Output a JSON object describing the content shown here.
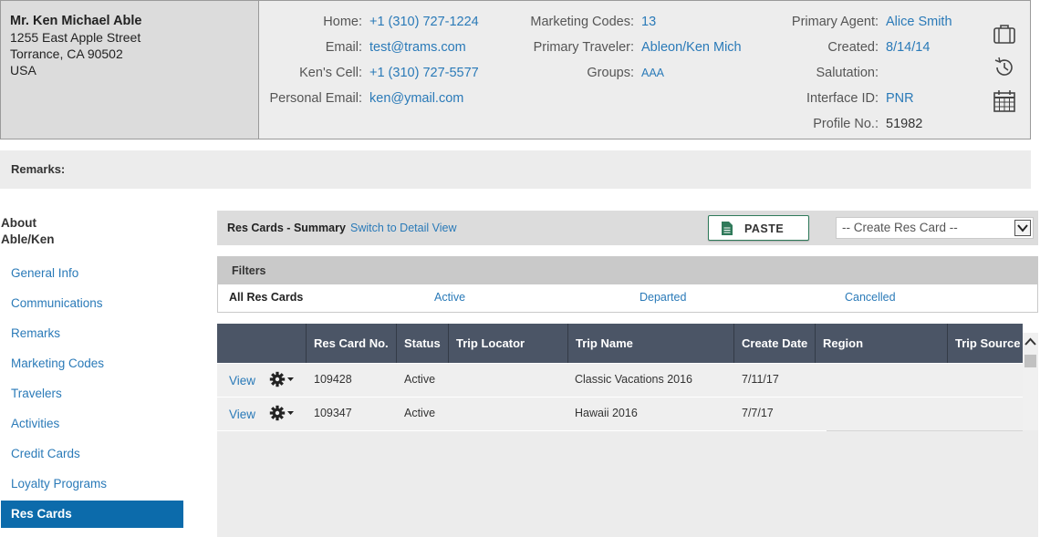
{
  "profile": {
    "name": "Mr. Ken Michael Able",
    "address_line1": "1255 East Apple Street",
    "address_line2": "Torrance, CA 90502",
    "country": "USA"
  },
  "contact": {
    "home_label": "Home:",
    "home_value": "+1 (310) 727-1224",
    "email_label": "Email:",
    "email_value": "test@trams.com",
    "cell_label": "Ken's Cell:",
    "cell_value": "+1 (310) 727-5577",
    "personal_email_label": "Personal Email:",
    "personal_email_value": "ken@ymail.com"
  },
  "marketing": {
    "codes_label": "Marketing Codes:",
    "codes_value": "13",
    "traveler_label": "Primary Traveler:",
    "traveler_value": "Ableon/Ken Mich",
    "groups_label": "Groups:",
    "groups_value": "AAA"
  },
  "agent": {
    "agent_label": "Primary Agent:",
    "agent_value": "Alice Smith",
    "created_label": "Created:",
    "created_value": "8/14/14",
    "salutation_label": "Salutation:",
    "salutation_value": "",
    "interface_label": "Interface ID:",
    "interface_value": "PNR",
    "profile_no_label": "Profile No.:",
    "profile_no_value": "51982"
  },
  "side_icons": [
    "briefcase-icon",
    "history-icon",
    "calendar-icon"
  ],
  "remarks": {
    "label": "Remarks:"
  },
  "about": {
    "line1": "About",
    "line2": "Able/Ken"
  },
  "nav": {
    "items": [
      {
        "label": "General Info"
      },
      {
        "label": "Communications"
      },
      {
        "label": "Remarks"
      },
      {
        "label": "Marketing Codes"
      },
      {
        "label": "Travelers"
      },
      {
        "label": "Activities"
      },
      {
        "label": "Credit Cards"
      },
      {
        "label": "Loyalty Programs"
      },
      {
        "label": "Res Cards"
      }
    ],
    "active": "Res Cards"
  },
  "summary": {
    "title": "Res Cards - Summary",
    "switch_link": "Switch to Detail View",
    "paste_label": "PASTE",
    "create_select": "-- Create Res Card --"
  },
  "filters": {
    "heading": "Filters",
    "options": [
      "All Res Cards",
      "Active",
      "Departed",
      "Cancelled"
    ],
    "selected": "All Res Cards"
  },
  "table": {
    "columns": [
      "",
      "Res Card No.",
      "Status",
      "Trip Locator",
      "Trip Name",
      "Create Date",
      "Region",
      "Trip Source"
    ],
    "rows": [
      {
        "action": "View",
        "res_card_no": "109428",
        "status": "Active",
        "trip_locator": "",
        "trip_name": "Classic Vacations 2016",
        "create_date": "7/11/17",
        "region": ""
      },
      {
        "action": "View",
        "res_card_no": "109347",
        "status": "Active",
        "trip_locator": "",
        "trip_name": "Hawaii 2016",
        "create_date": "7/7/17",
        "region": ""
      }
    ]
  },
  "colors": {
    "link": "#2a7ab8",
    "nav_active": "#0c6bab",
    "table_header": "#4b5566",
    "paste_border": "#2f7a5a"
  }
}
